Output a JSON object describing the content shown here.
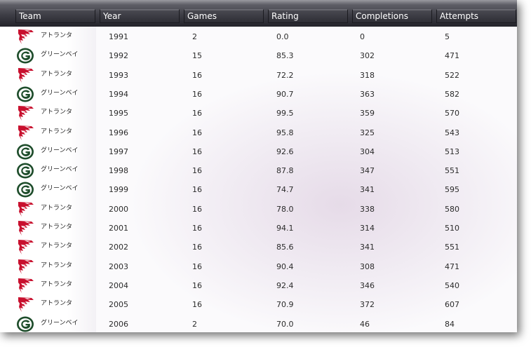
{
  "columns": [
    "Team",
    "Year",
    "Games",
    "Rating",
    "Completions",
    "Attempts"
  ],
  "rows": [
    {
      "team": "アトランタ",
      "logo": "falcons-logo-icon",
      "year": "1991",
      "games": "2",
      "rating": "0.0",
      "completions": "0",
      "attempts": "5"
    },
    {
      "team": "グリーンベイ",
      "logo": "packers-logo-icon",
      "year": "1992",
      "games": "15",
      "rating": "85.3",
      "completions": "302",
      "attempts": "471"
    },
    {
      "team": "アトランタ",
      "logo": "falcons-logo-icon",
      "year": "1993",
      "games": "16",
      "rating": "72.2",
      "completions": "318",
      "attempts": "522"
    },
    {
      "team": "グリーンベイ",
      "logo": "packers-logo-icon",
      "year": "1994",
      "games": "16",
      "rating": "90.7",
      "completions": "363",
      "attempts": "582"
    },
    {
      "team": "アトランタ",
      "logo": "falcons-logo-icon",
      "year": "1995",
      "games": "16",
      "rating": "99.5",
      "completions": "359",
      "attempts": "570"
    },
    {
      "team": "アトランタ",
      "logo": "falcons-logo-icon",
      "year": "1996",
      "games": "16",
      "rating": "95.8",
      "completions": "325",
      "attempts": "543"
    },
    {
      "team": "グリーンベイ",
      "logo": "packers-logo-icon",
      "year": "1997",
      "games": "16",
      "rating": "92.6",
      "completions": "304",
      "attempts": "513"
    },
    {
      "team": "グリーンベイ",
      "logo": "packers-logo-icon",
      "year": "1998",
      "games": "16",
      "rating": "87.8",
      "completions": "347",
      "attempts": "551"
    },
    {
      "team": "グリーンベイ",
      "logo": "packers-logo-icon",
      "year": "1999",
      "games": "16",
      "rating": "74.7",
      "completions": "341",
      "attempts": "595"
    },
    {
      "team": "アトランタ",
      "logo": "falcons-logo-icon",
      "year": "2000",
      "games": "16",
      "rating": "78.0",
      "completions": "338",
      "attempts": "580"
    },
    {
      "team": "アトランタ",
      "logo": "falcons-logo-icon",
      "year": "2001",
      "games": "16",
      "rating": "94.1",
      "completions": "314",
      "attempts": "510"
    },
    {
      "team": "アトランタ",
      "logo": "falcons-logo-icon",
      "year": "2002",
      "games": "16",
      "rating": "85.6",
      "completions": "341",
      "attempts": "551"
    },
    {
      "team": "アトランタ",
      "logo": "falcons-logo-icon",
      "year": "2003",
      "games": "16",
      "rating": "90.4",
      "completions": "308",
      "attempts": "471"
    },
    {
      "team": "アトランタ",
      "logo": "falcons-logo-icon",
      "year": "2004",
      "games": "16",
      "rating": "92.4",
      "completions": "346",
      "attempts": "540"
    },
    {
      "team": "アトランタ",
      "logo": "falcons-logo-icon",
      "year": "2005",
      "games": "16",
      "rating": "70.9",
      "completions": "372",
      "attempts": "607"
    },
    {
      "team": "グリーンベイ",
      "logo": "packers-logo-icon",
      "year": "2006",
      "games": "2",
      "rating": "70.0",
      "completions": "46",
      "attempts": "84"
    }
  ],
  "colors": {
    "falcons_red": "#c8102e",
    "packers_green": "#1e4d2b",
    "packers_gold": "#ffb612"
  }
}
